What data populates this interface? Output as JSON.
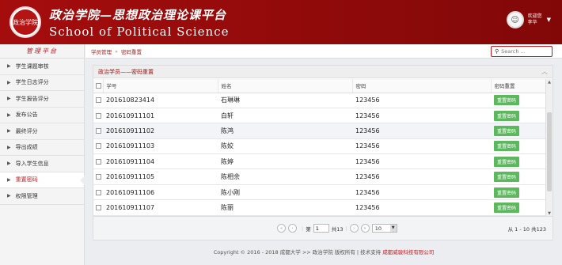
{
  "header": {
    "logo_text": "政治学院",
    "title_cn": "政治学院—思想政治理论课平台",
    "title_en": "School of Political Science",
    "user_greeting": "欢迎您",
    "user_name": "李华"
  },
  "sidebar": {
    "title": "管理平台",
    "items": [
      {
        "label": "学生课题审核"
      },
      {
        "label": "学生日志评分"
      },
      {
        "label": "学生报告评分"
      },
      {
        "label": "发布公告"
      },
      {
        "label": "最终评分"
      },
      {
        "label": "导出成绩"
      },
      {
        "label": "导入学生信息"
      },
      {
        "label": "重置密码"
      },
      {
        "label": "权限管理"
      }
    ]
  },
  "breadcrumb": {
    "root": "学员管理",
    "sep": "»",
    "current": "密码重置"
  },
  "search": {
    "placeholder": "Search ..."
  },
  "panel": {
    "title": "政治学员——密码重置"
  },
  "table": {
    "headers": {
      "id": "学号",
      "name": "姓名",
      "password": "密码",
      "reset": "密码重置"
    },
    "rows": [
      {
        "id": "201610823414",
        "name": "石琳琳",
        "password": "123456",
        "btn": "重置密码"
      },
      {
        "id": "201610911101",
        "name": "白轩",
        "password": "123456",
        "btn": "重置密码"
      },
      {
        "id": "201610911102",
        "name": "陈鸿",
        "password": "123456",
        "btn": "重置密码"
      },
      {
        "id": "201610911103",
        "name": "陈姣",
        "password": "123456",
        "btn": "重置密码"
      },
      {
        "id": "201610911104",
        "name": "陈婷",
        "password": "123456",
        "btn": "重置密码"
      },
      {
        "id": "201610911105",
        "name": "陈相余",
        "password": "123456",
        "btn": "重置密码"
      },
      {
        "id": "201610911106",
        "name": "陈小刚",
        "password": "123456",
        "btn": "重置密码"
      },
      {
        "id": "201610911107",
        "name": "陈丽",
        "password": "123456",
        "btn": "重置密码"
      }
    ]
  },
  "pager": {
    "page_prefix": "第",
    "page_value": "1",
    "page_suffix": "共13",
    "page_size": "10",
    "range_text": "从 1 - 10 共123"
  },
  "footer": {
    "text": "Copyright © 2016 - 2018 成都大学 >> 政治学院 版权所有 | 技术支持 ",
    "link": "成都威骏科技有限公司"
  }
}
